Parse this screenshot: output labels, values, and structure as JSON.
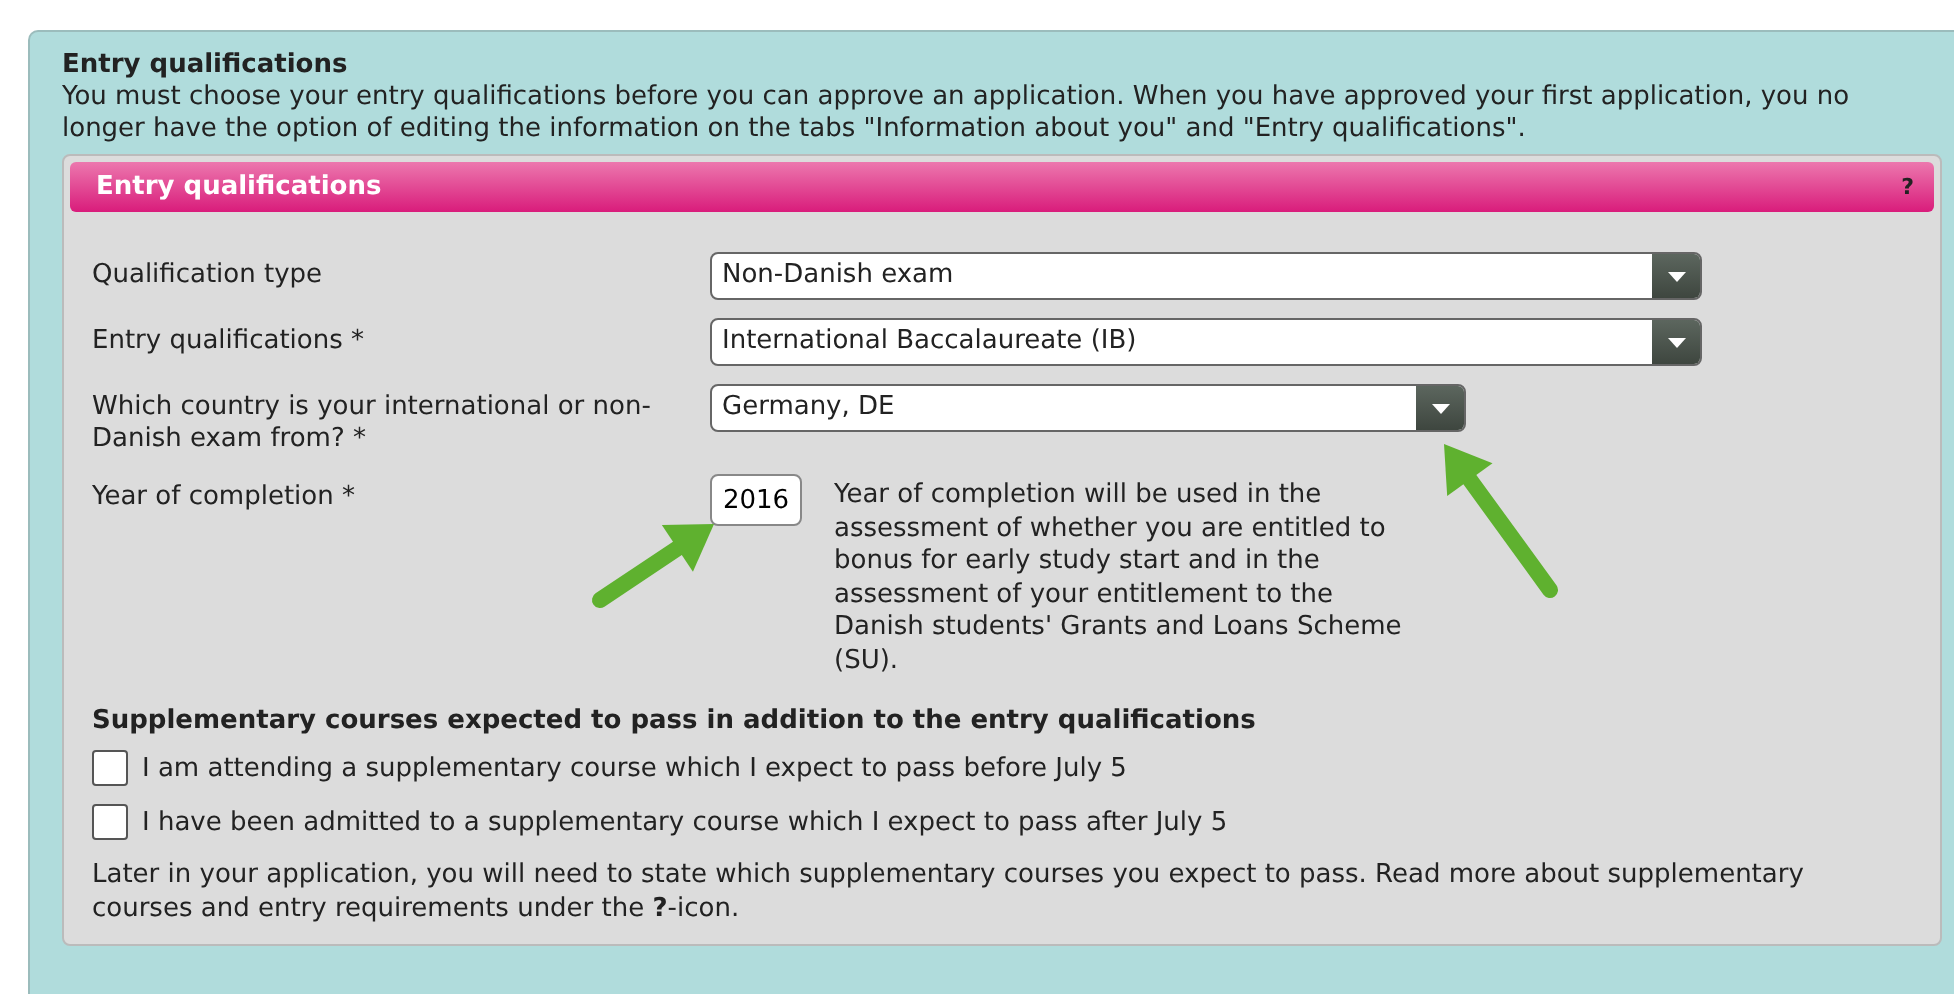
{
  "section": {
    "title": "Entry qualifications",
    "intro": "You must choose your entry qualifications before you can approve an application. When you have approved your first application, you no longer have the option of editing the information on the tabs \"Information about you\" and \"Entry qualifications\"."
  },
  "panel": {
    "title": "Entry qualifications",
    "help": "?"
  },
  "fields": [
    {
      "kind": "select",
      "label": "Qualification type",
      "value": "Non-Danish exam",
      "wide": true
    },
    {
      "kind": "select",
      "label": "Entry qualifications *",
      "value": "International Baccalaureate (IB)",
      "wide": true
    },
    {
      "kind": "select",
      "label": "Which country is your international or non-Danish exam from? *",
      "value": "Germany, DE",
      "wide": false
    },
    {
      "kind": "year",
      "label": "Year of completion *",
      "value": "2016",
      "note": "Year of completion will be used in the assessment of whether you are entitled to bonus for early study start and in the assessment of your entitlement to the Danish students' Grants and Loans Scheme (SU)."
    }
  ],
  "supplementary": {
    "heading": "Supplementary courses expected to pass in addition to the entry qualifications",
    "options": [
      {
        "label": "I am attending a supplementary course which I expect to pass before July 5",
        "checked": false
      },
      {
        "label": "I have been admitted to a supplementary course which I expect to pass after July 5",
        "checked": false
      }
    ],
    "note": "Later in your application, you will need to state which supplementary courses you expect to pass. Read more about supplementary courses and entry requirements under the **?**-icon."
  },
  "annotations": [
    {
      "kind": "arrow"
    },
    {
      "kind": "arrow"
    }
  ]
}
